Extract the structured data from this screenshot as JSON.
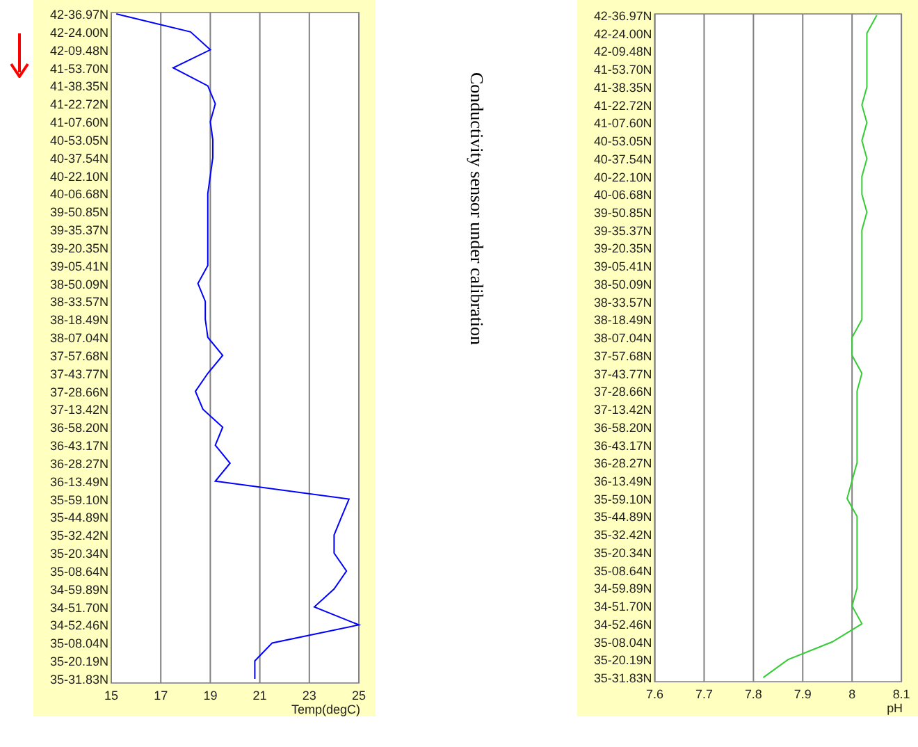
{
  "charts": [
    {
      "chart_data": {
        "type": "line",
        "orientation": "horizontal",
        "grid": true,
        "xlabel": "Temp(degC)",
        "xlim": [
          15,
          25
        ],
        "xticks": [
          15,
          17,
          19,
          21,
          23,
          25
        ],
        "categories": [
          "42-36.97N",
          "42-24.00N",
          "42-09.48N",
          "41-53.70N",
          "41-38.35N",
          "41-22.72N",
          "41-07.60N",
          "40-53.05N",
          "40-37.54N",
          "40-22.10N",
          "40-06.68N",
          "39-50.85N",
          "39-35.37N",
          "39-20.35N",
          "39-05.41N",
          "38-50.09N",
          "38-33.57N",
          "38-18.49N",
          "38-07.04N",
          "37-57.68N",
          "37-43.77N",
          "37-28.66N",
          "37-13.42N",
          "36-58.20N",
          "36-43.17N",
          "36-28.27N",
          "36-13.49N",
          "35-59.10N",
          "35-44.89N",
          "35-32.42N",
          "35-20.34N",
          "35-08.64N",
          "34-59.89N",
          "34-51.70N",
          "34-52.46N",
          "35-08.04N",
          "35-20.19N",
          "35-31.83N"
        ],
        "series": [
          {
            "color": "#0000ff",
            "values": [
              15.2,
              18.2,
              19.0,
              17.5,
              18.9,
              19.2,
              19.0,
              19.1,
              19.1,
              19.0,
              18.9,
              18.9,
              18.9,
              18.9,
              18.9,
              18.5,
              18.8,
              18.8,
              18.9,
              19.5,
              18.9,
              18.4,
              18.7,
              19.5,
              19.2,
              19.8,
              19.2,
              24.6,
              24.3,
              24.0,
              24.0,
              24.5,
              24.0,
              23.2,
              25.0,
              21.5,
              20.8,
              20.8
            ]
          }
        ]
      }
    },
    {
      "chart_data": {
        "type": "line",
        "orientation": "horizontal",
        "grid": true,
        "xlabel": "pH",
        "xlim": [
          7.6,
          8.1
        ],
        "xticks": [
          7.6,
          7.7,
          7.8,
          7.9,
          8,
          8.1
        ],
        "categories": [
          "42-36.97N",
          "42-24.00N",
          "42-09.48N",
          "41-53.70N",
          "41-38.35N",
          "41-22.72N",
          "41-07.60N",
          "40-53.05N",
          "40-37.54N",
          "40-22.10N",
          "40-06.68N",
          "39-50.85N",
          "39-35.37N",
          "39-20.35N",
          "39-05.41N",
          "38-50.09N",
          "38-33.57N",
          "38-18.49N",
          "38-07.04N",
          "37-57.68N",
          "37-43.77N",
          "37-28.66N",
          "37-13.42N",
          "36-58.20N",
          "36-43.17N",
          "36-28.27N",
          "36-13.49N",
          "35-59.10N",
          "35-44.89N",
          "35-32.42N",
          "35-20.34N",
          "35-08.64N",
          "34-59.89N",
          "34-51.70N",
          "34-52.46N",
          "35-08.04N",
          "35-20.19N",
          "35-31.83N"
        ],
        "series": [
          {
            "color": "#33cc33",
            "values": [
              8.05,
              8.03,
              8.03,
              8.03,
              8.03,
              8.02,
              8.03,
              8.02,
              8.03,
              8.02,
              8.02,
              8.03,
              8.02,
              8.02,
              8.02,
              8.02,
              8.02,
              8.02,
              8.0,
              8.0,
              8.02,
              8.01,
              8.01,
              8.01,
              8.01,
              8.01,
              8.0,
              7.99,
              8.01,
              8.01,
              8.01,
              8.01,
              8.01,
              8.0,
              8.02,
              7.96,
              7.87,
              7.82
            ]
          }
        ]
      }
    }
  ],
  "annotation": "Conductivity sensor under calibration"
}
